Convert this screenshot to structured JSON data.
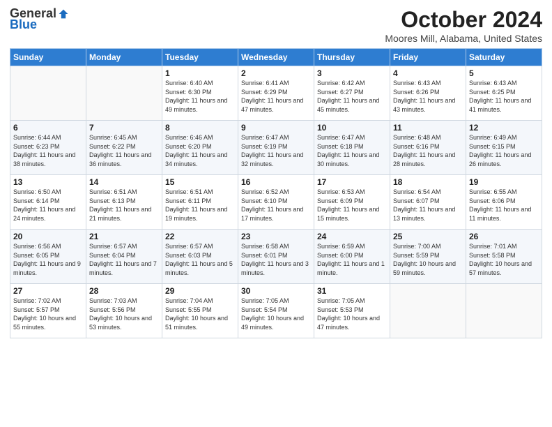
{
  "logo": {
    "general": "General",
    "blue": "Blue"
  },
  "title": "October 2024",
  "subtitle": "Moores Mill, Alabama, United States",
  "days_of_week": [
    "Sunday",
    "Monday",
    "Tuesday",
    "Wednesday",
    "Thursday",
    "Friday",
    "Saturday"
  ],
  "weeks": [
    [
      {
        "day": "",
        "info": ""
      },
      {
        "day": "",
        "info": ""
      },
      {
        "day": "1",
        "info": "Sunrise: 6:40 AM\nSunset: 6:30 PM\nDaylight: 11 hours and 49 minutes."
      },
      {
        "day": "2",
        "info": "Sunrise: 6:41 AM\nSunset: 6:29 PM\nDaylight: 11 hours and 47 minutes."
      },
      {
        "day": "3",
        "info": "Sunrise: 6:42 AM\nSunset: 6:27 PM\nDaylight: 11 hours and 45 minutes."
      },
      {
        "day": "4",
        "info": "Sunrise: 6:43 AM\nSunset: 6:26 PM\nDaylight: 11 hours and 43 minutes."
      },
      {
        "day": "5",
        "info": "Sunrise: 6:43 AM\nSunset: 6:25 PM\nDaylight: 11 hours and 41 minutes."
      }
    ],
    [
      {
        "day": "6",
        "info": "Sunrise: 6:44 AM\nSunset: 6:23 PM\nDaylight: 11 hours and 38 minutes."
      },
      {
        "day": "7",
        "info": "Sunrise: 6:45 AM\nSunset: 6:22 PM\nDaylight: 11 hours and 36 minutes."
      },
      {
        "day": "8",
        "info": "Sunrise: 6:46 AM\nSunset: 6:20 PM\nDaylight: 11 hours and 34 minutes."
      },
      {
        "day": "9",
        "info": "Sunrise: 6:47 AM\nSunset: 6:19 PM\nDaylight: 11 hours and 32 minutes."
      },
      {
        "day": "10",
        "info": "Sunrise: 6:47 AM\nSunset: 6:18 PM\nDaylight: 11 hours and 30 minutes."
      },
      {
        "day": "11",
        "info": "Sunrise: 6:48 AM\nSunset: 6:16 PM\nDaylight: 11 hours and 28 minutes."
      },
      {
        "day": "12",
        "info": "Sunrise: 6:49 AM\nSunset: 6:15 PM\nDaylight: 11 hours and 26 minutes."
      }
    ],
    [
      {
        "day": "13",
        "info": "Sunrise: 6:50 AM\nSunset: 6:14 PM\nDaylight: 11 hours and 24 minutes."
      },
      {
        "day": "14",
        "info": "Sunrise: 6:51 AM\nSunset: 6:13 PM\nDaylight: 11 hours and 21 minutes."
      },
      {
        "day": "15",
        "info": "Sunrise: 6:51 AM\nSunset: 6:11 PM\nDaylight: 11 hours and 19 minutes."
      },
      {
        "day": "16",
        "info": "Sunrise: 6:52 AM\nSunset: 6:10 PM\nDaylight: 11 hours and 17 minutes."
      },
      {
        "day": "17",
        "info": "Sunrise: 6:53 AM\nSunset: 6:09 PM\nDaylight: 11 hours and 15 minutes."
      },
      {
        "day": "18",
        "info": "Sunrise: 6:54 AM\nSunset: 6:07 PM\nDaylight: 11 hours and 13 minutes."
      },
      {
        "day": "19",
        "info": "Sunrise: 6:55 AM\nSunset: 6:06 PM\nDaylight: 11 hours and 11 minutes."
      }
    ],
    [
      {
        "day": "20",
        "info": "Sunrise: 6:56 AM\nSunset: 6:05 PM\nDaylight: 11 hours and 9 minutes."
      },
      {
        "day": "21",
        "info": "Sunrise: 6:57 AM\nSunset: 6:04 PM\nDaylight: 11 hours and 7 minutes."
      },
      {
        "day": "22",
        "info": "Sunrise: 6:57 AM\nSunset: 6:03 PM\nDaylight: 11 hours and 5 minutes."
      },
      {
        "day": "23",
        "info": "Sunrise: 6:58 AM\nSunset: 6:01 PM\nDaylight: 11 hours and 3 minutes."
      },
      {
        "day": "24",
        "info": "Sunrise: 6:59 AM\nSunset: 6:00 PM\nDaylight: 11 hours and 1 minute."
      },
      {
        "day": "25",
        "info": "Sunrise: 7:00 AM\nSunset: 5:59 PM\nDaylight: 10 hours and 59 minutes."
      },
      {
        "day": "26",
        "info": "Sunrise: 7:01 AM\nSunset: 5:58 PM\nDaylight: 10 hours and 57 minutes."
      }
    ],
    [
      {
        "day": "27",
        "info": "Sunrise: 7:02 AM\nSunset: 5:57 PM\nDaylight: 10 hours and 55 minutes."
      },
      {
        "day": "28",
        "info": "Sunrise: 7:03 AM\nSunset: 5:56 PM\nDaylight: 10 hours and 53 minutes."
      },
      {
        "day": "29",
        "info": "Sunrise: 7:04 AM\nSunset: 5:55 PM\nDaylight: 10 hours and 51 minutes."
      },
      {
        "day": "30",
        "info": "Sunrise: 7:05 AM\nSunset: 5:54 PM\nDaylight: 10 hours and 49 minutes."
      },
      {
        "day": "31",
        "info": "Sunrise: 7:05 AM\nSunset: 5:53 PM\nDaylight: 10 hours and 47 minutes."
      },
      {
        "day": "",
        "info": ""
      },
      {
        "day": "",
        "info": ""
      }
    ]
  ]
}
